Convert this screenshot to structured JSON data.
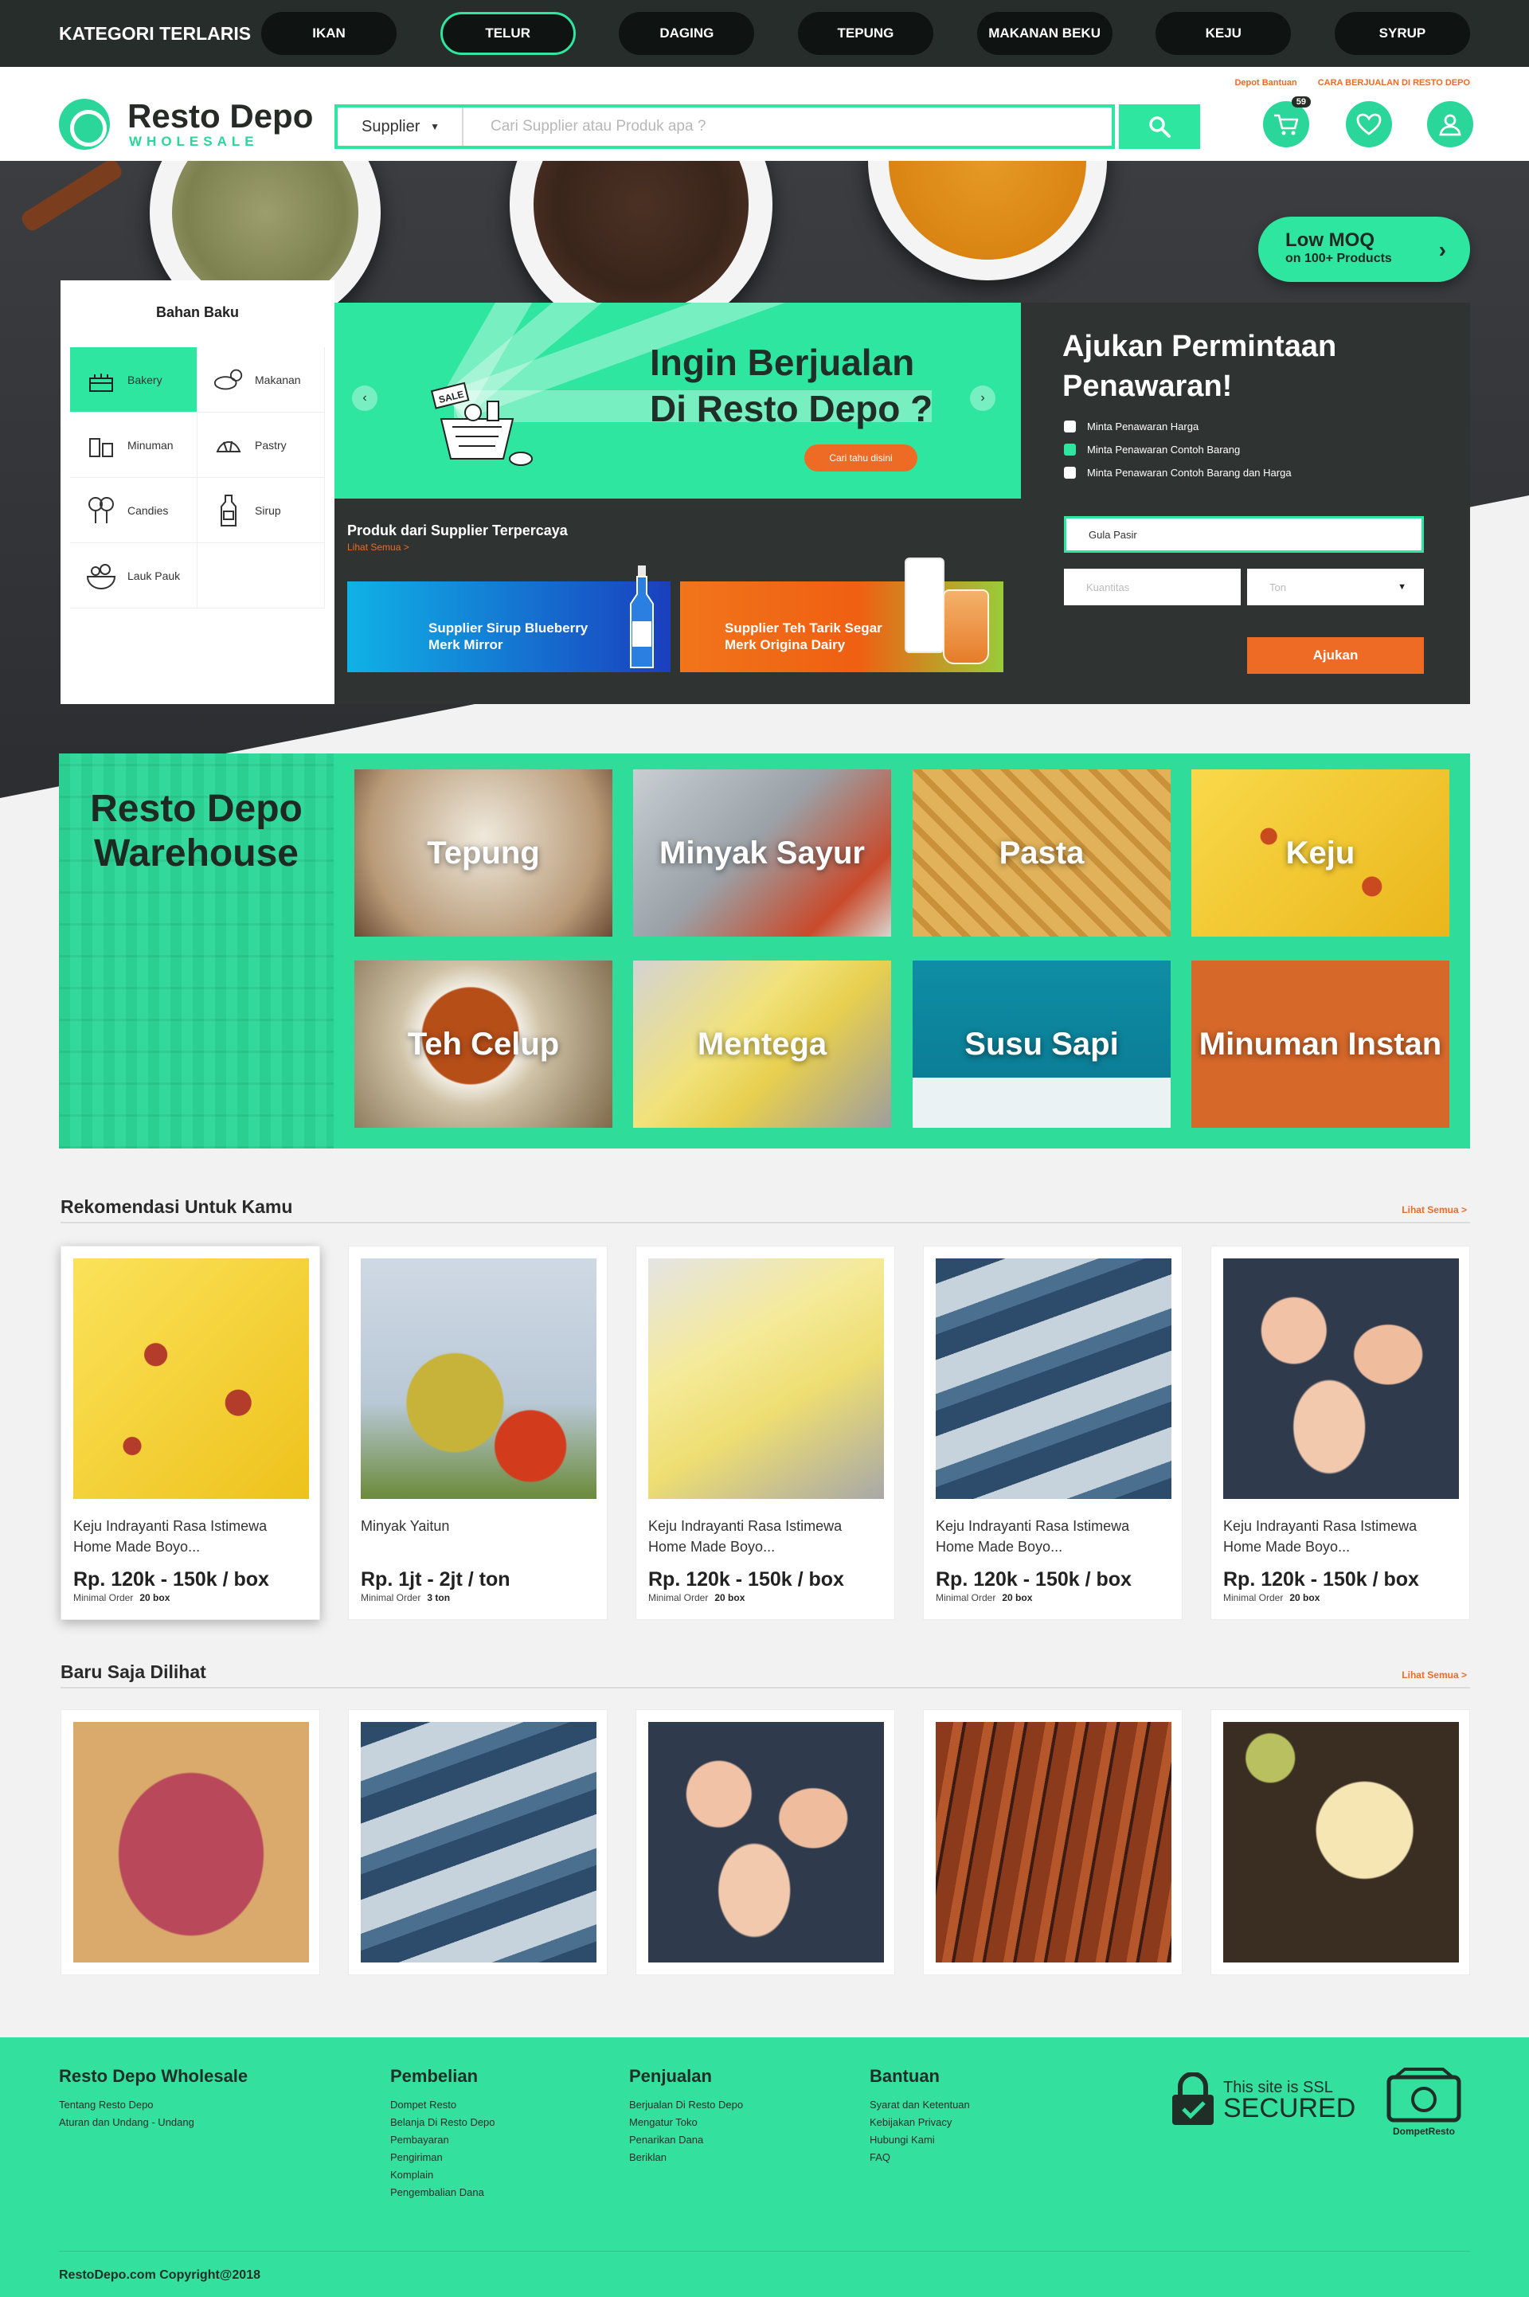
{
  "catbar": {
    "title": "KATEGORI TERLARIS",
    "items": [
      "IKAN",
      "TELUR",
      "DAGING",
      "TEPUNG",
      "MAKANAN BEKU",
      "KEJU",
      "SYRUP"
    ],
    "active": "TELUR"
  },
  "header": {
    "brand": "Resto Depo",
    "brand_sub": "WHOLESALE",
    "search": {
      "select_value": "Supplier",
      "placeholder": "Cari Supplier atau Produk apa ?"
    },
    "links": [
      "Depot Bantuan",
      "CARA BERJUALAN DI RESTO DEPO"
    ],
    "cart_count": "59"
  },
  "hero": {
    "lowmoq": {
      "title": "Low MOQ",
      "sub": "on 100+ Products"
    },
    "bahan": {
      "title": "Bahan Baku",
      "items": [
        "Bakery",
        "Makanan",
        "Minuman",
        "Pastry",
        "Candies",
        "Sirup",
        "Lauk Pauk"
      ],
      "active": "Bakery"
    },
    "slide": {
      "line1": "Ingin Berjualan",
      "line2": "Di Resto Depo ?",
      "cta": "Cari tahu disini",
      "badge": "SALE"
    },
    "trusted": {
      "title": "Produk dari Supplier Terpercaya",
      "link": "Lihat Semua >",
      "s1": {
        "l1": "Supplier Sirup Blueberry",
        "l2": "Merk Mirror"
      },
      "s2": {
        "l1": "Supplier Teh Tarik Segar",
        "l2": "Merk Origina Dairy"
      }
    },
    "ajukan": {
      "l1": "Ajukan Permintaan",
      "l2": "Penawaran!",
      "options": [
        "Minta Penawaran Harga",
        "Minta Penawaran Contoh Barang",
        "Minta Penawaran Contoh Barang dan Harga"
      ],
      "selected_option": 1,
      "product_value": "Gula Pasir",
      "qty_placeholder": "Kuantitas",
      "unit_value": "Ton",
      "submit": "Ajukan"
    }
  },
  "warehouse": {
    "l1": "Resto Depo",
    "l2": "Warehouse",
    "tiles": [
      "Tepung",
      "Minyak Sayur",
      "Pasta",
      "Keju",
      "Teh Celup",
      "Mentega",
      "Susu Sapi",
      "Minuman Instan"
    ]
  },
  "rekomendasi": {
    "title": "Rekomendasi Untuk Kamu",
    "link": "Lihat Semua >",
    "min_label": "Minimal Order",
    "products": [
      {
        "l1": "Keju Indrayanti Rasa Istimewa",
        "l2": "Home Made Boyo...",
        "price": "Rp. 120k - 150k / box",
        "min": "20 box"
      },
      {
        "l1": "Minyak Yaitun",
        "l2": "",
        "price": "Rp. 1jt - 2jt / ton",
        "min": "3 ton"
      },
      {
        "l1": "Keju Indrayanti Rasa Istimewa",
        "l2": "Home Made Boyo...",
        "price": "Rp. 120k - 150k / box",
        "min": "20 box"
      },
      {
        "l1": "Keju Indrayanti Rasa Istimewa",
        "l2": "Home Made Boyo...",
        "price": "Rp. 120k - 150k / box",
        "min": "20 box"
      },
      {
        "l1": "Keju Indrayanti Rasa Istimewa",
        "l2": "Home Made Boyo...",
        "price": "Rp. 120k - 150k / box",
        "min": "20 box"
      }
    ]
  },
  "baru": {
    "title": "Baru Saja Dilihat",
    "link": "Lihat Semua >"
  },
  "footer": {
    "col1": {
      "title": "Resto Depo Wholesale",
      "links": [
        "Tentang Resto Depo",
        "Aturan dan Undang - Undang"
      ]
    },
    "col2": {
      "title": "Pembelian",
      "links": [
        "Dompet Resto",
        "Belanja Di Resto Depo",
        "Pembayaran",
        "Pengiriman",
        "Komplain",
        "Pengembalian Dana"
      ]
    },
    "col3": {
      "title": "Penjualan",
      "links": [
        "Berjualan Di Resto Depo",
        "Mengatur Toko",
        "Penarikan Dana",
        "Beriklan"
      ]
    },
    "col4": {
      "title": "Bantuan",
      "links": [
        "Syarat dan Ketentuan",
        "Kebijakan Privacy",
        "Hubungi Kami",
        "FAQ"
      ]
    },
    "ssl1": "This site is SSL",
    "ssl2": "SECURED",
    "dompet": "DompetResto",
    "copyright": "RestoDepo.com  Copyright@2018"
  }
}
